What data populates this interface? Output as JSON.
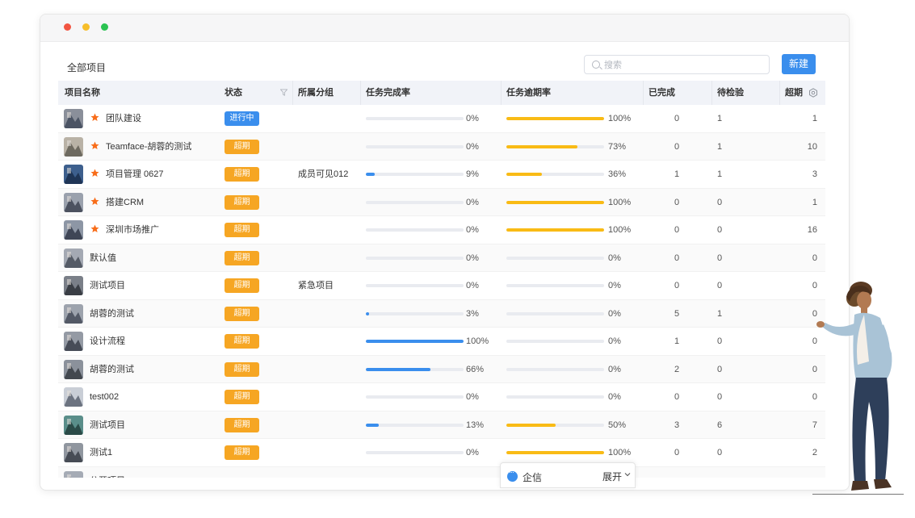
{
  "breadcrumb": "全部项目",
  "search": {
    "placeholder": "搜索"
  },
  "new_button": "新建",
  "columns": {
    "name": "项目名称",
    "status": "状态",
    "group": "所属分组",
    "completion": "任务完成率",
    "overdue": "任务逾期率",
    "done": "已完成",
    "pending": "待检验",
    "over": "超期"
  },
  "colors": {
    "blue": "#3a8eed",
    "orange": "#f6a623",
    "yellow": "#f9bb15",
    "star": "#f86d1a"
  },
  "rows": [
    {
      "name": "团队建设",
      "star": true,
      "status": "进行中",
      "status_type": "blue",
      "group": "",
      "completion": "0%",
      "completion_value": 0,
      "overdue": "100%",
      "overdue_value": 100,
      "done": "0",
      "pending": "1",
      "over": "1"
    },
    {
      "name": "Teamface-胡蓉的测试",
      "star": true,
      "status": "超期",
      "status_type": "orange",
      "group": "",
      "completion": "0%",
      "completion_value": 0,
      "overdue": "73%",
      "overdue_value": 73,
      "done": "0",
      "pending": "1",
      "over": "10"
    },
    {
      "name": "项目管理 0627",
      "star": true,
      "status": "超期",
      "status_type": "orange",
      "group": "成员可见012",
      "completion": "9%",
      "completion_value": 9,
      "overdue": "36%",
      "overdue_value": 36,
      "done": "1",
      "pending": "1",
      "over": "3"
    },
    {
      "name": "搭建CRM",
      "star": true,
      "status": "超期",
      "status_type": "orange",
      "group": "",
      "completion": "0%",
      "completion_value": 0,
      "overdue": "100%",
      "overdue_value": 100,
      "done": "0",
      "pending": "0",
      "over": "1"
    },
    {
      "name": "深圳市场推广",
      "star": true,
      "status": "超期",
      "status_type": "orange",
      "group": "",
      "completion": "0%",
      "completion_value": 0,
      "overdue": "100%",
      "overdue_value": 100,
      "done": "0",
      "pending": "0",
      "over": "16"
    },
    {
      "name": "默认值",
      "star": false,
      "status": "超期",
      "status_type": "orange",
      "group": "",
      "completion": "0%",
      "completion_value": 0,
      "overdue": "0%",
      "overdue_value": 0,
      "done": "0",
      "pending": "0",
      "over": "0"
    },
    {
      "name": "测试项目",
      "star": false,
      "status": "超期",
      "status_type": "orange",
      "group": "紧急项目",
      "completion": "0%",
      "completion_value": 0,
      "overdue": "0%",
      "overdue_value": 0,
      "done": "0",
      "pending": "0",
      "over": "0"
    },
    {
      "name": "胡蓉的测试",
      "star": false,
      "status": "超期",
      "status_type": "orange",
      "group": "",
      "completion": "3%",
      "completion_value": 3,
      "overdue": "0%",
      "overdue_value": 0,
      "done": "5",
      "pending": "1",
      "over": "0"
    },
    {
      "name": "设计流程",
      "star": false,
      "status": "超期",
      "status_type": "orange",
      "group": "",
      "completion": "100%",
      "completion_value": 100,
      "overdue": "0%",
      "overdue_value": 0,
      "done": "1",
      "pending": "0",
      "over": "0"
    },
    {
      "name": "胡蓉的测试",
      "star": false,
      "status": "超期",
      "status_type": "orange",
      "group": "",
      "completion": "66%",
      "completion_value": 66,
      "overdue": "0%",
      "overdue_value": 0,
      "done": "2",
      "pending": "0",
      "over": "0"
    },
    {
      "name": "test002",
      "star": false,
      "status": "超期",
      "status_type": "orange",
      "group": "",
      "completion": "0%",
      "completion_value": 0,
      "overdue": "0%",
      "overdue_value": 0,
      "done": "0",
      "pending": "0",
      "over": "0"
    },
    {
      "name": "测试项目",
      "star": false,
      "status": "超期",
      "status_type": "orange",
      "group": "",
      "completion": "13%",
      "completion_value": 13,
      "overdue": "50%",
      "overdue_value": 50,
      "done": "3",
      "pending": "6",
      "over": "7"
    },
    {
      "name": "测试1",
      "star": false,
      "status": "超期",
      "status_type": "orange",
      "group": "",
      "completion": "0%",
      "completion_value": 0,
      "overdue": "100%",
      "overdue_value": 100,
      "done": "0",
      "pending": "0",
      "over": "2"
    },
    {
      "name": "公开项目",
      "star": false,
      "status": "",
      "status_type": "orange",
      "group": "",
      "completion": "",
      "completion_value": 0,
      "overdue": "",
      "overdue_value": 0,
      "done": "",
      "pending": "",
      "over": ""
    }
  ],
  "chat": {
    "label": "企信",
    "expand": "展开"
  }
}
